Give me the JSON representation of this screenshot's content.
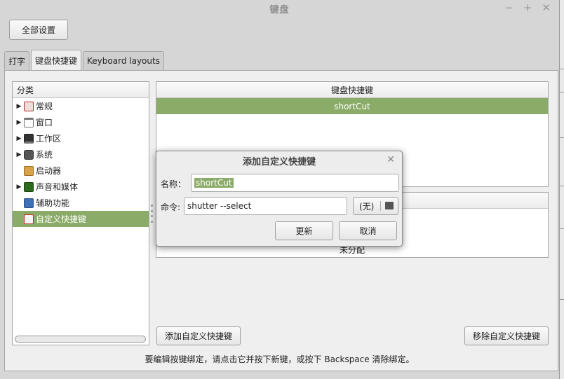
{
  "window": {
    "title": "键盘"
  },
  "toolbar": {
    "all_settings": "全部设置"
  },
  "tabs": [
    {
      "label": "打字"
    },
    {
      "label": "键盘快捷键"
    },
    {
      "label": "Keyboard layouts"
    }
  ],
  "categories": {
    "header": "分类",
    "items": [
      {
        "label": "常规",
        "expandable": true,
        "icon": "general-icon"
      },
      {
        "label": "窗口",
        "expandable": true,
        "icon": "window-icon"
      },
      {
        "label": "工作区",
        "expandable": true,
        "icon": "workspace-icon"
      },
      {
        "label": "系统",
        "expandable": true,
        "icon": "system-icon"
      },
      {
        "label": "启动器",
        "expandable": false,
        "icon": "launcher-icon"
      },
      {
        "label": "声音和媒体",
        "expandable": true,
        "icon": "media-icon"
      },
      {
        "label": "辅助功能",
        "expandable": false,
        "icon": "accessibility-icon"
      },
      {
        "label": "自定义快捷键",
        "expandable": false,
        "icon": "custom-shortcut-icon",
        "selected": true
      }
    ]
  },
  "shortcuts": {
    "header": "键盘快捷键",
    "rows": [
      {
        "label": "shortCut",
        "selected": true
      }
    ]
  },
  "bindings": {
    "unassigned": "未分配"
  },
  "buttons": {
    "add_custom": "添加自定义快捷键",
    "remove_custom": "移除自定义快捷键"
  },
  "hint": "要编辑按键绑定，请点击它并按下新键，或按下 Backspace 清除绑定。",
  "dialog": {
    "title": "添加自定义快捷键",
    "name_label": "名称：",
    "name_value": "shortCut",
    "command_label": "命令:",
    "command_value": "shutter --select",
    "browse_none": "(无)",
    "update_button": "更新",
    "cancel_button": "取消"
  },
  "colors": {
    "selection": "#8bab68",
    "window_bg": "#d6d6d6",
    "pane_bg": "#efefef"
  }
}
